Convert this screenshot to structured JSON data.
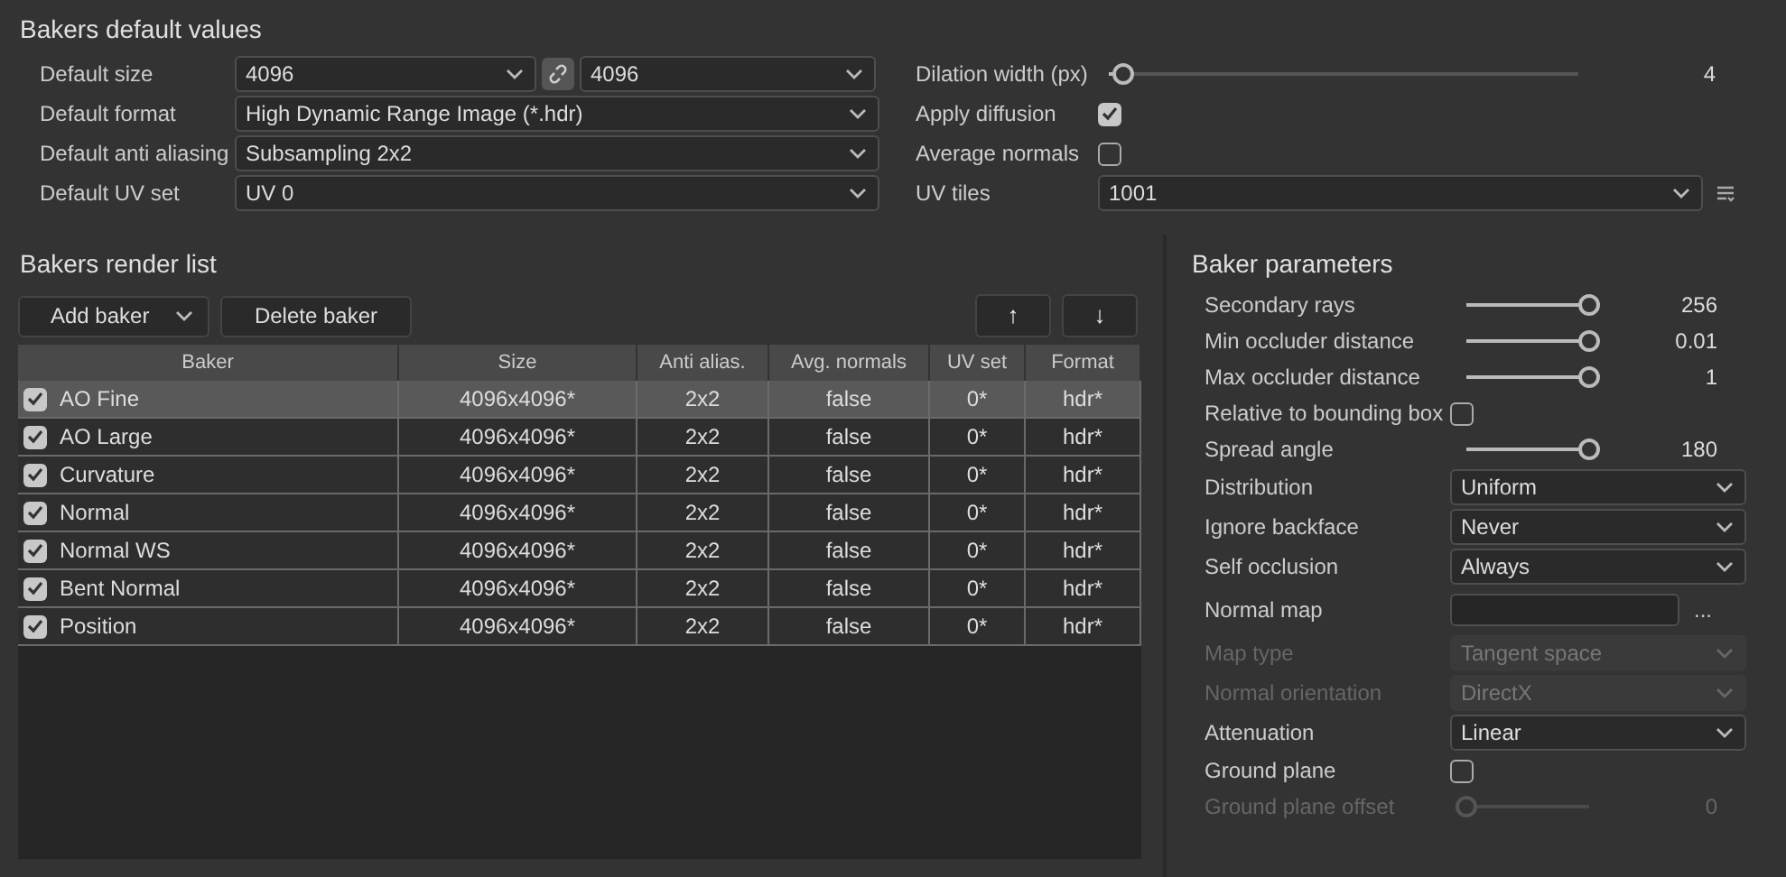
{
  "defaults": {
    "title": "Bakers default values",
    "left": [
      {
        "kind": "size",
        "label": "Default size",
        "value": "4096",
        "value2": "4096",
        "linked": true
      },
      {
        "kind": "select",
        "label": "Default format",
        "value": "High Dynamic Range Image (*.hdr)"
      },
      {
        "kind": "select",
        "label": "Default anti aliasing",
        "value": "Subsampling 2x2"
      },
      {
        "kind": "select",
        "label": "Default UV set",
        "value": "UV 0"
      }
    ],
    "right": [
      {
        "kind": "slider",
        "label": "Dilation width (px)",
        "level": 0.03,
        "reading": "4"
      },
      {
        "kind": "checkbox",
        "label": "Apply diffusion",
        "checked": true
      },
      {
        "kind": "checkbox",
        "label": "Average normals",
        "checked": false
      },
      {
        "kind": "tiles",
        "label": "UV tiles",
        "value": "1001"
      }
    ]
  },
  "render_list": {
    "title": "Bakers render list",
    "add_button": "Add baker",
    "delete_button": "Delete baker",
    "up_button": "↑",
    "down_button": "↓",
    "columns": [
      "Baker",
      "Size",
      "Anti alias.",
      "Avg. normals",
      "UV set",
      "Format"
    ],
    "rows": [
      {
        "checked": true,
        "selected": true,
        "cells": [
          "AO Fine",
          "4096x4096*",
          "2x2",
          "false",
          "0*",
          "hdr*"
        ]
      },
      {
        "checked": true,
        "selected": false,
        "cells": [
          "AO Large",
          "4096x4096*",
          "2x2",
          "false",
          "0*",
          "hdr*"
        ]
      },
      {
        "checked": true,
        "selected": false,
        "cells": [
          "Curvature",
          "4096x4096*",
          "2x2",
          "false",
          "0*",
          "hdr*"
        ]
      },
      {
        "checked": true,
        "selected": false,
        "cells": [
          "Normal",
          "4096x4096*",
          "2x2",
          "false",
          "0*",
          "hdr*"
        ]
      },
      {
        "checked": true,
        "selected": false,
        "cells": [
          "Normal WS",
          "4096x4096*",
          "2x2",
          "false",
          "0*",
          "hdr*"
        ]
      },
      {
        "checked": true,
        "selected": false,
        "cells": [
          "Bent Normal",
          "4096x4096*",
          "2x2",
          "false",
          "0*",
          "hdr*"
        ]
      },
      {
        "checked": true,
        "selected": false,
        "cells": [
          "Position",
          "4096x4096*",
          "2x2",
          "false",
          "0*",
          "hdr*"
        ]
      }
    ]
  },
  "parameters": {
    "title": "Baker parameters",
    "items": [
      {
        "kind": "slider",
        "label": "Secondary rays",
        "level": 1,
        "reading": "256",
        "disabled": false
      },
      {
        "kind": "slider",
        "label": "Min occluder distance",
        "level": 1,
        "reading": "0.01",
        "disabled": false
      },
      {
        "kind": "slider",
        "label": "Max occluder distance",
        "level": 1,
        "reading": "1",
        "disabled": false
      },
      {
        "kind": "checkbox",
        "label": "Relative to bounding box",
        "checked": false,
        "disabled": false
      },
      {
        "kind": "slider",
        "label": "Spread angle",
        "level": 1,
        "reading": "180",
        "disabled": false
      },
      {
        "kind": "select",
        "label": "Distribution",
        "value": "Uniform",
        "disabled": false
      },
      {
        "kind": "select",
        "label": "Ignore backface",
        "value": "Never",
        "disabled": false
      },
      {
        "kind": "select",
        "label": "Self occlusion",
        "value": "Always",
        "disabled": false
      },
      {
        "kind": "file",
        "label": "Normal map",
        "button": "...",
        "disabled": false
      },
      {
        "kind": "select",
        "label": "Map type",
        "value": "Tangent space",
        "disabled": true
      },
      {
        "kind": "select",
        "label": "Normal orientation",
        "value": "DirectX",
        "disabled": true
      },
      {
        "kind": "select",
        "label": "Attenuation",
        "value": "Linear",
        "disabled": false
      },
      {
        "kind": "checkbox",
        "label": "Ground plane",
        "checked": false,
        "disabled": false
      },
      {
        "kind": "slider",
        "label": "Ground plane offset",
        "level": 0,
        "reading": "0",
        "disabled": true
      }
    ]
  }
}
